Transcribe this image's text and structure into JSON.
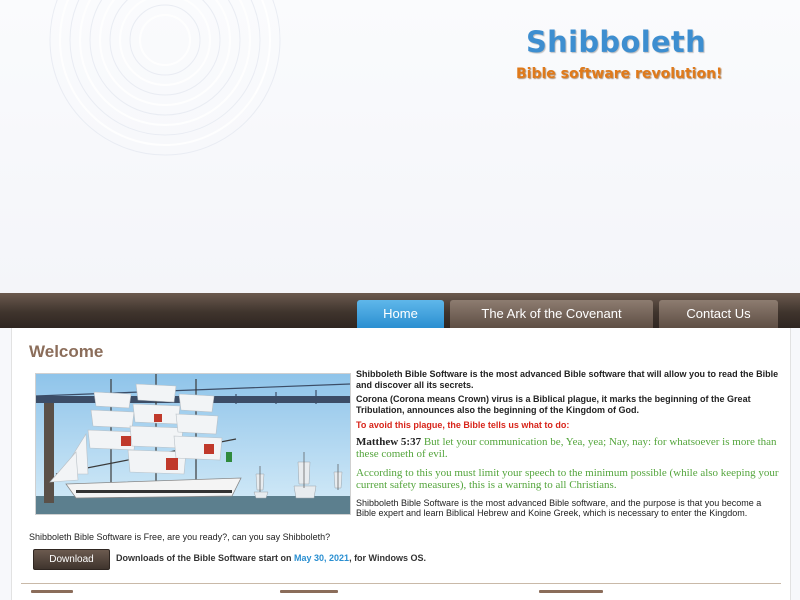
{
  "brand": {
    "title": "Shibboleth",
    "subtitle": "Bible software revolution!"
  },
  "nav": {
    "items": [
      {
        "label": "Home",
        "active": true
      },
      {
        "label": "The Ark of the Covenant",
        "active": false
      },
      {
        "label": "Contact Us",
        "active": false
      }
    ]
  },
  "main": {
    "heading": "Welcome",
    "p1": "Shibboleth Bible Software is the most advanced Bible software that will allow you to read the Bible and discover all its secrets.",
    "p2": "Corona (Corona means Crown) virus is a Biblical plague, it marks the beginning of the Great Tribulation, announces also the beginning of the Kingdom of God.",
    "p3": "To avoid this plague, the Bible tells us what to do:",
    "verse_ref": "Matthew 5:37",
    "verse_text": "But let your communication be, Yea, yea; Nay, nay: for whatsoever is more than these cometh of evil.",
    "p5": "According to this you must limit your speech to the minimum possible (while also keeping your current safety measures), this is a warning to all Christians.",
    "p6": "Shibboleth Bible Software is the most advanced Bible software, and the purpose is that you become a Bible expert and learn Biblical Hebrew and Koine Greek, which is necessary to enter the Kingdom.",
    "free_line": "Shibboleth Bible Software is Free, are you ready?, can you say Shibboleth?",
    "download_label": "Download",
    "download_pre": "Downloads of the Bible Software start on ",
    "download_date": "May 30, 2021",
    "download_post": ", for Windows OS."
  },
  "colors": {
    "accent_blue": "#2a8fd1",
    "brand_orange": "#e07a1a",
    "nav_brown": "#3f342d",
    "heading_brown": "#8b6d5a",
    "warning_red": "#d8251b",
    "verse_green": "#54a53c"
  }
}
